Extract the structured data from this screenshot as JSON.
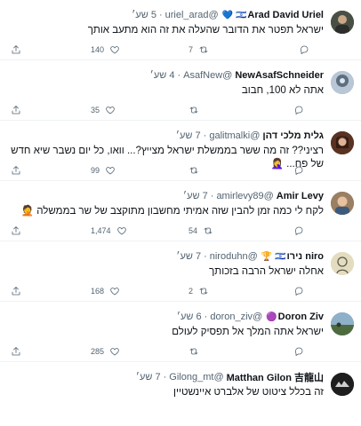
{
  "colors": {
    "muted": "#536471",
    "text": "#0f1419",
    "divider": "#eff3f4"
  },
  "tweets": [
    {
      "name": "Arad David Uriel",
      "emoji": "🇮🇱 💙",
      "handle": "@uriel_arad",
      "time": "5 שע׳",
      "text": "ישראל תפטר את הדובר שהעלה את זה הוא מתעב אותך",
      "reply_count": "7",
      "retweet_count": "",
      "like_count": "140"
    },
    {
      "name": "NewAsafSchneider",
      "emoji": "",
      "handle": "@AsafNew",
      "time": "4 שע׳",
      "text": "אתה לא 100, חבוב",
      "reply_count": "",
      "retweet_count": "",
      "like_count": "35"
    },
    {
      "name": "גלית מלכי דהן",
      "emoji": "",
      "handle": "@galitmalki",
      "time": "7 שע׳",
      "text": "רציני?? זה מה ששר בממשלת ישראל מצייץ?... וואו, כל יום נשבר שיא חדש של פח... 🤦‍♀️",
      "reply_count": "",
      "retweet_count": "",
      "like_count": "99"
    },
    {
      "name": "Amir Levy",
      "emoji": "",
      "handle": "@amirlevy89",
      "time": "7 שע׳",
      "text": "לקח לי כמה זמן להבין שזה אמיתי מחשבון מתוקצב של שר בממשלה 🤦",
      "reply_count": "",
      "retweet_count": "54",
      "like_count": "1,474"
    },
    {
      "name": "niro נירו",
      "emoji": "🇮🇱 🏆",
      "handle": "@niroduhn",
      "time": "7 שע׳",
      "text": "אחלה ישראל הרבה בזכותך",
      "reply_count": "",
      "retweet_count": "2",
      "like_count": "168"
    },
    {
      "name": "Doron Ziv",
      "emoji": "🟣",
      "handle": "@doron_ziv",
      "time": "6 שע׳",
      "text": "ישראל אתה המלך אל תפסיק לעולם",
      "reply_count": "",
      "retweet_count": "",
      "like_count": "285"
    },
    {
      "name": "Matthan Gilon 吉龍山",
      "emoji": "",
      "handle": "@Gilong_mt",
      "time": "7 שע׳",
      "text": "זה בכלל ציטוט של אלברט איינשטיין",
      "reply_count": "",
      "retweet_count": "",
      "like_count": ""
    }
  ]
}
